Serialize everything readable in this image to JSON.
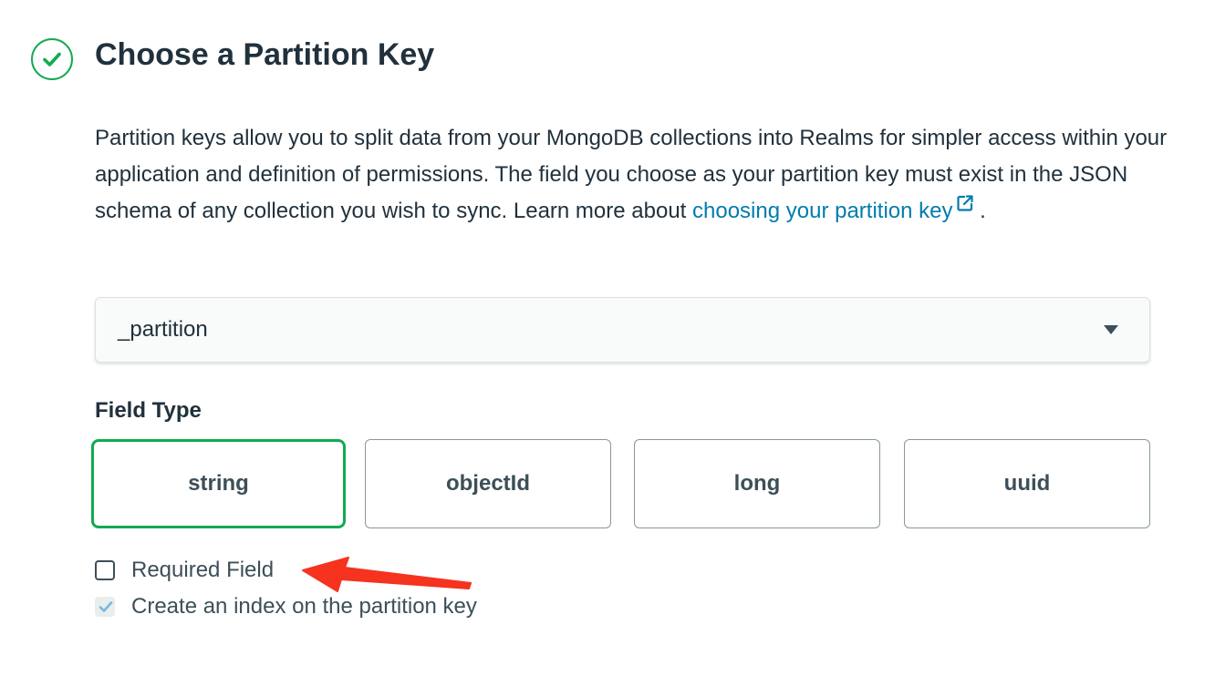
{
  "section": {
    "title": "Choose a Partition Key",
    "status_icon": "check-circle-icon",
    "status_color": "#13aa52"
  },
  "description": {
    "text": "Partition keys allow you to split data from your MongoDB collections into Realms for simpler access within your application and definition of permissions. The field you choose as your partition key must exist in the JSON schema of any collection you wish to sync. Learn more about ",
    "link_text": "choosing your partition key",
    "link_icon": "external-link-icon",
    "suffix": " ."
  },
  "partition_select": {
    "value": "_partition",
    "icon": "caret-down-icon"
  },
  "field_type": {
    "label": "Field Type",
    "options": [
      {
        "label": "string",
        "selected": true
      },
      {
        "label": "objectId",
        "selected": false
      },
      {
        "label": "long",
        "selected": false
      },
      {
        "label": "uuid",
        "selected": false
      }
    ]
  },
  "options": {
    "required_field": {
      "label": "Required Field",
      "checked": false
    },
    "create_index": {
      "label": "Create an index on the partition key",
      "checked": true,
      "disabled": true
    }
  },
  "annotation": {
    "icon": "red-arrow-annotation",
    "color": "#f5331f"
  }
}
